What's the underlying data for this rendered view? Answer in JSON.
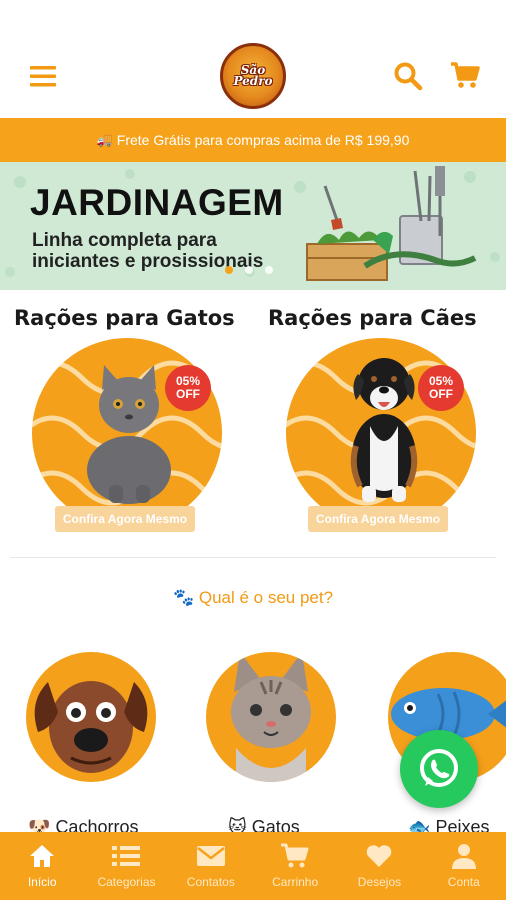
{
  "header": {
    "logo_text_line1": "São",
    "logo_text_line2": "Pedro"
  },
  "promo": {
    "text": "Frete Grátis para compras acima de R$ 199,90"
  },
  "banner": {
    "title": "JARDINAGEM",
    "subtitle": "Linha completa para iniciantes e prosissionais",
    "slides": 3,
    "active_slide": 0
  },
  "products": [
    {
      "title": "Rações para Gatos",
      "badge_pct": "05%",
      "badge_label": "OFF",
      "cta": "Confira Agora Mesmo"
    },
    {
      "title": "Rações para Cães",
      "badge_pct": "05%",
      "badge_label": "OFF",
      "cta": "Confira Agora Mesmo"
    }
  ],
  "pets_section": {
    "question": "Qual é o seu pet?",
    "items": [
      {
        "label": "Cachorros",
        "icon": "dog-icon"
      },
      {
        "label": "Gatos",
        "icon": "cat-icon"
      },
      {
        "label": "Peixes",
        "icon": "fish-icon"
      }
    ]
  },
  "bottom_nav": [
    {
      "label": "Início",
      "icon": "home-icon",
      "active": true
    },
    {
      "label": "Categorias",
      "icon": "list-icon",
      "active": false
    },
    {
      "label": "Contatos",
      "icon": "mail-icon",
      "active": false
    },
    {
      "label": "Carrinho",
      "icon": "cart-icon",
      "active": false
    },
    {
      "label": "Desejos",
      "icon": "heart-icon",
      "active": false
    },
    {
      "label": "Conta",
      "icon": "user-icon",
      "active": false
    }
  ],
  "colors": {
    "brand_orange": "#f6a21b",
    "badge_red": "#e53a2f",
    "whatsapp_green": "#25c95d",
    "banner_bg": "#cfe9d4"
  }
}
